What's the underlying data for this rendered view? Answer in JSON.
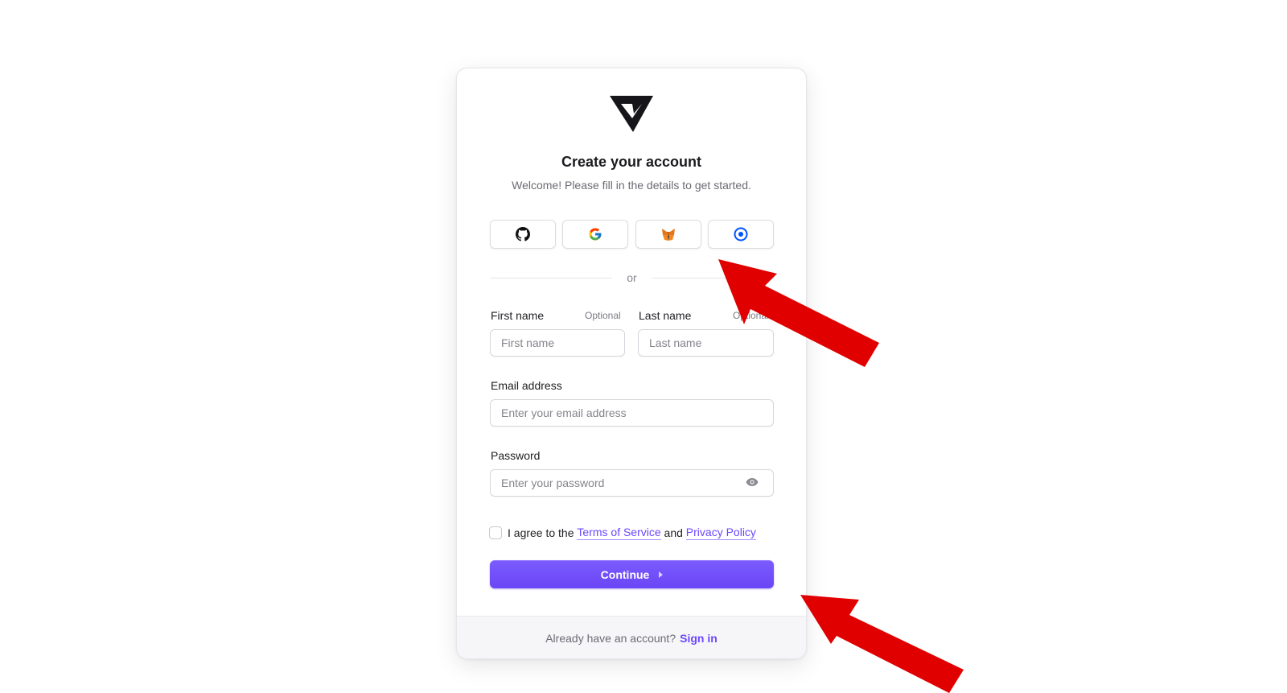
{
  "card": {
    "title": "Create your account",
    "subtitle": "Welcome! Please fill in the details to get started.",
    "logo_icon": "brand-v-logo-icon"
  },
  "social": [
    {
      "provider_icon": "github-icon"
    },
    {
      "provider_icon": "google-icon"
    },
    {
      "provider_icon": "metamask-fox-icon"
    },
    {
      "provider_icon": "coinbase-circle-icon"
    }
  ],
  "divider_text": "or",
  "form": {
    "first_name": {
      "label": "First name",
      "optional": "Optional",
      "placeholder": "First name"
    },
    "last_name": {
      "label": "Last name",
      "optional": "Optional",
      "placeholder": "Last name"
    },
    "email": {
      "label": "Email address",
      "placeholder": "Enter your email address"
    },
    "password": {
      "label": "Password",
      "placeholder": "Enter your password"
    },
    "agree": {
      "prefix": "I agree to the",
      "terms": "Terms of Service",
      "and": "and",
      "privacy": "Privacy Policy"
    },
    "continue_label": "Continue"
  },
  "footer": {
    "prompt": "Already have an account?",
    "signin": "Sign in"
  },
  "colors": {
    "accent": "#6c47ff",
    "annotation_arrow": "#e00000"
  }
}
